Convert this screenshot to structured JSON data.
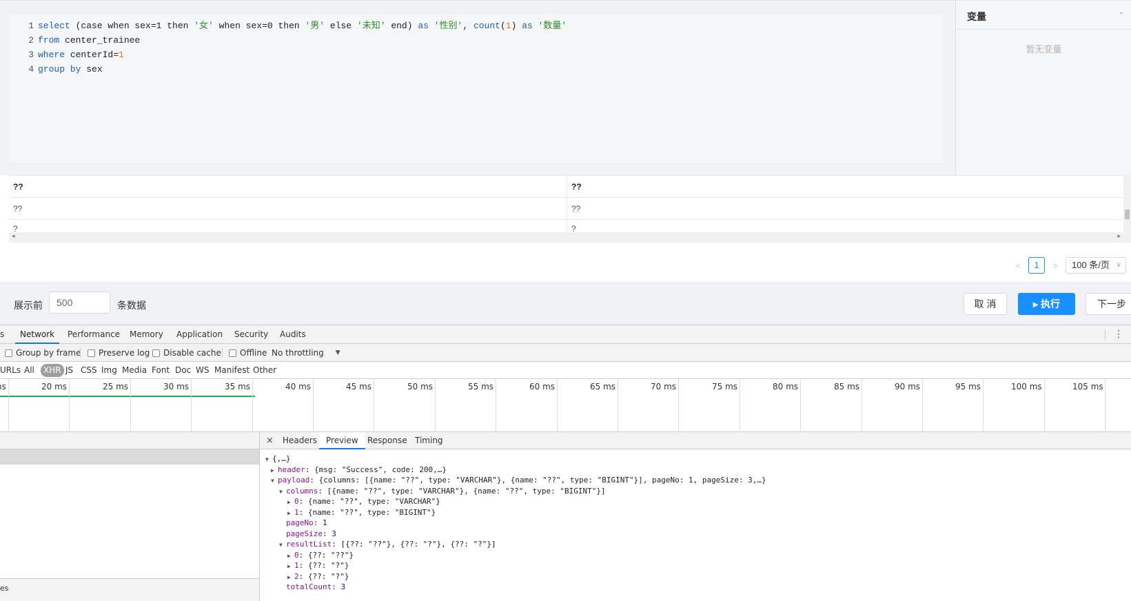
{
  "editor": {
    "line_numbers": [
      "1",
      "2",
      "3",
      "4"
    ],
    "line1": {
      "select": "select",
      "a": " (case when sex=1 then ",
      "s1": "'女'",
      "b": " when sex=0 then ",
      "s2": "'男'",
      "c": " else ",
      "s3": "'未知'",
      "d": " end) ",
      "as1": "as",
      "s4": " '性别'",
      "e": ", ",
      "count": "count",
      "f": "(",
      "one": "1",
      "g": ") ",
      "as2": "as",
      "s5": " '数量'"
    },
    "line2": {
      "from": "from",
      "rest": " center_trainee"
    },
    "line3": {
      "where": "where",
      "rest": " centerId=",
      "num": "1"
    },
    "line4": {
      "group": "group",
      "by": "by",
      "rest": " sex"
    }
  },
  "variables": {
    "title": "变量",
    "empty": "暂无变量",
    "collapse": "-"
  },
  "result": {
    "headers": [
      "??",
      "??"
    ],
    "rows": [
      [
        "??",
        "??"
      ],
      [
        "?",
        "?"
      ]
    ],
    "scroll_left": "◂",
    "scroll_right": "▸"
  },
  "pager": {
    "prev": "<",
    "page": "1",
    "next": ">",
    "size": "100 条/页",
    "size_caret": "∨"
  },
  "actions": {
    "show_label": "展示前",
    "show_value": "500",
    "show_suffix": "条数据",
    "cancel": "取 消",
    "run": "▸  执行",
    "next": "下一步"
  },
  "devtools": {
    "tabs": [
      "s",
      "Network",
      "Performance",
      "Memory",
      "Application",
      "Security",
      "Audits"
    ],
    "more": "⋮",
    "toolbar": {
      "group_by_frame": "Group by frame",
      "preserve_log": "Preserve log",
      "disable_cache": "Disable cache",
      "offline": "Offline",
      "throttling": "No throttling",
      "throttle_caret": "▼"
    },
    "filters": [
      "URLs",
      "All",
      "XHR",
      "JS",
      "CSS",
      "Img",
      "Media",
      "Font",
      "Doc",
      "WS",
      "Manifest",
      "Other"
    ],
    "timeline": [
      "ns",
      "20 ms",
      "25 ms",
      "30 ms",
      "35 ms",
      "40 ms",
      "45 ms",
      "50 ms",
      "55 ms",
      "60 ms",
      "65 ms",
      "70 ms",
      "75 ms",
      "80 ms",
      "85 ms",
      "90 ms",
      "95 ms",
      "100 ms",
      "105 ms"
    ],
    "left_footer": "es",
    "detail_close": "×",
    "detail_tabs": [
      "Headers",
      "Preview",
      "Response",
      "Timing"
    ],
    "json": {
      "root": "{,…}",
      "header_key": "header",
      "header_val": ": {msg: \"Success\", code: 200,…}",
      "payload_key": "payload",
      "payload_val": ": {columns: [{name: \"??\", type: \"VARCHAR\"}, {name: \"??\", type: \"BIGINT\"}], pageNo: 1, pageSize: 3,…}",
      "columns_key": "columns",
      "columns_val": ": [{name: \"??\", type: \"VARCHAR\"}, {name: \"??\", type: \"BIGINT\"}]",
      "col0_key": "0",
      "col0_val": ": {name: \"??\", type: \"VARCHAR\"}",
      "col1_key": "1",
      "col1_val": ": {name: \"??\", type: \"BIGINT\"}",
      "pageNo_key": "pageNo",
      "pageNo_val": "1",
      "pageSize_key": "pageSize",
      "pageSize_val": "3",
      "resultList_key": "resultList",
      "resultList_val": ": [{??: \"??\"}, {??: \"?\"}, {??: \"?\"}]",
      "r0_key": "0",
      "r0_val": ": {??: \"??\"}",
      "r1_key": "1",
      "r1_val": ": {??: \"?\"}",
      "r2_key": "2",
      "r2_val": ": {??: \"?\"}",
      "totalCount_key": "totalCount",
      "totalCount_val": "3"
    }
  }
}
